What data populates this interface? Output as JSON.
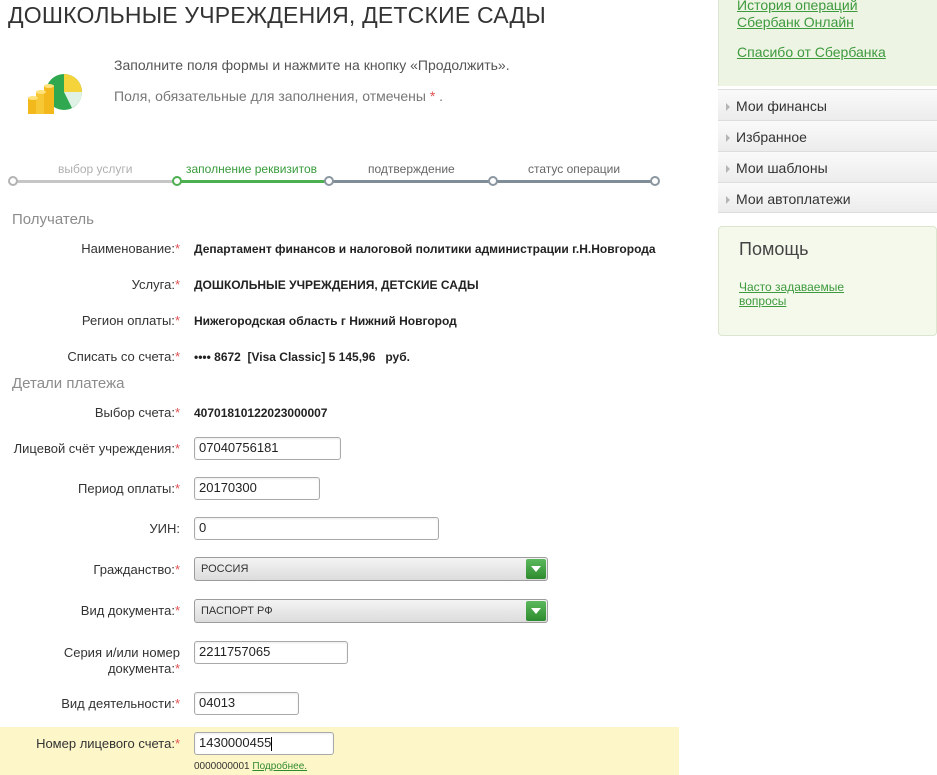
{
  "page": {
    "title": "ДОШКОЛЬНЫЕ УЧРЕЖДЕНИЯ, ДЕТСКИЕ САДЫ",
    "intro_text": "Заполните поля формы и нажмите на кнопку «Продолжить».",
    "required_note": "Поля, обязательные для заполнения, отмечены",
    "required_star": "*",
    "required_period": "."
  },
  "progress": {
    "steps": [
      {
        "label": "выбор услуги",
        "state": "done"
      },
      {
        "label": "заполнение реквизитов",
        "state": "active"
      },
      {
        "label": "подтверждение",
        "state": "pending"
      },
      {
        "label": "статус операции",
        "state": "pending"
      }
    ]
  },
  "recipient": {
    "title": "Получатель",
    "rows": [
      {
        "label": "Наименование:",
        "value": "Департамент финансов и налоговой политики администрации г.Н.Новгорода"
      },
      {
        "label": "Услуга:",
        "value": "ДОШКОЛЬНЫЕ УЧРЕЖДЕНИЯ, ДЕТСКИЕ САДЫ"
      },
      {
        "label": "Регион оплаты:",
        "value": "Нижегородская область г Нижний Новгород"
      },
      {
        "label": "Списать со счета:",
        "value": "•••• 8672  [Visa Classic] 5 145,96   руб."
      }
    ]
  },
  "details": {
    "title": "Детали платежа",
    "account_choice": {
      "label": "Выбор счета:",
      "value": "40701810122023000007"
    },
    "institution_account": {
      "label": "Лицевой счёт учреждения:",
      "value": "07040756181"
    },
    "payment_period": {
      "label": "Период оплаты:",
      "value": "20170300"
    },
    "uin": {
      "label": "УИН:",
      "value": "0"
    },
    "citizenship": {
      "label": "Гражданство:",
      "value": "РОССИЯ"
    },
    "document_type": {
      "label": "Вид документа:",
      "value": "ПАСПОРТ РФ"
    },
    "document_number": {
      "label_line1": "Серия и/или номер",
      "label_line2": "документа:",
      "value": "2211757065"
    },
    "activity_type": {
      "label": "Вид деятельности:",
      "value": "04013"
    },
    "personal_account": {
      "label": "Номер лицевого счета:",
      "value": "1430000455",
      "hint": "0000000001",
      "hint_link": "Подробнее."
    }
  },
  "sidebar": {
    "top_links": [
      "История операций",
      "Сбербанк Онлайн",
      "Спасибо от Сбербанка"
    ],
    "menu": [
      "Мои финансы",
      "Избранное",
      "Мои шаблоны",
      "Мои автоплатежи"
    ],
    "help": {
      "title": "Помощь",
      "faq_line1": "Часто задаваемые",
      "faq_line2": "вопросы"
    }
  },
  "colors": {
    "accent_green": "#379b3b",
    "required_red": "#e05050",
    "highlight": "#fdf6c9"
  }
}
